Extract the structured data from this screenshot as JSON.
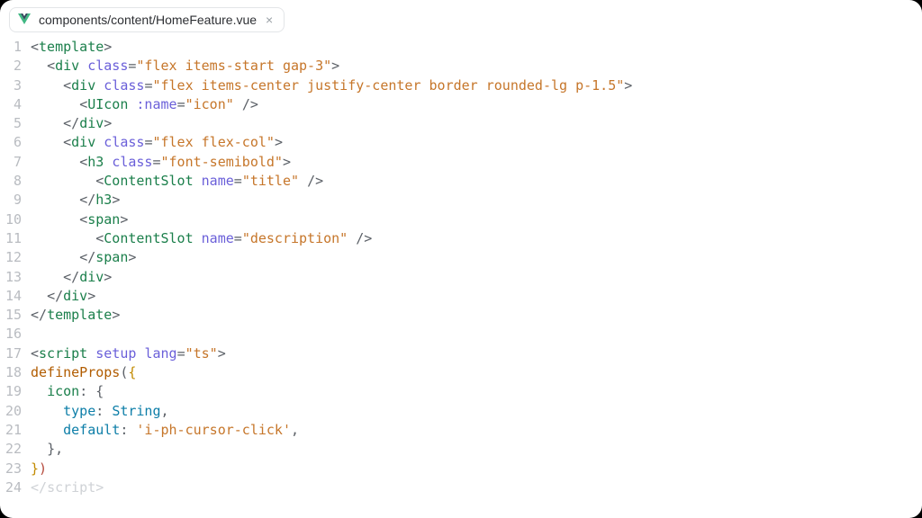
{
  "tab": {
    "filename": "components/content/HomeFeature.vue",
    "icon": "vue-icon",
    "close_label": "×"
  },
  "code_lines": [
    "<template>",
    "  <div class=\"flex items-start gap-3\">",
    "    <div class=\"flex items-center justify-center border rounded-lg p-1.5\">",
    "      <UIcon :name=\"icon\" />",
    "    </div>",
    "    <div class=\"flex flex-col\">",
    "      <h3 class=\"font-semibold\">",
    "        <ContentSlot name=\"title\" />",
    "      </h3>",
    "      <span>",
    "        <ContentSlot name=\"description\" />",
    "      </span>",
    "    </div>",
    "  </div>",
    "</template>",
    "",
    "<script setup lang=\"ts\">",
    "defineProps({",
    "  icon: {",
    "    type: String,",
    "    default: 'i-ph-cursor-click',",
    "  },",
    "})",
    "</script>"
  ]
}
